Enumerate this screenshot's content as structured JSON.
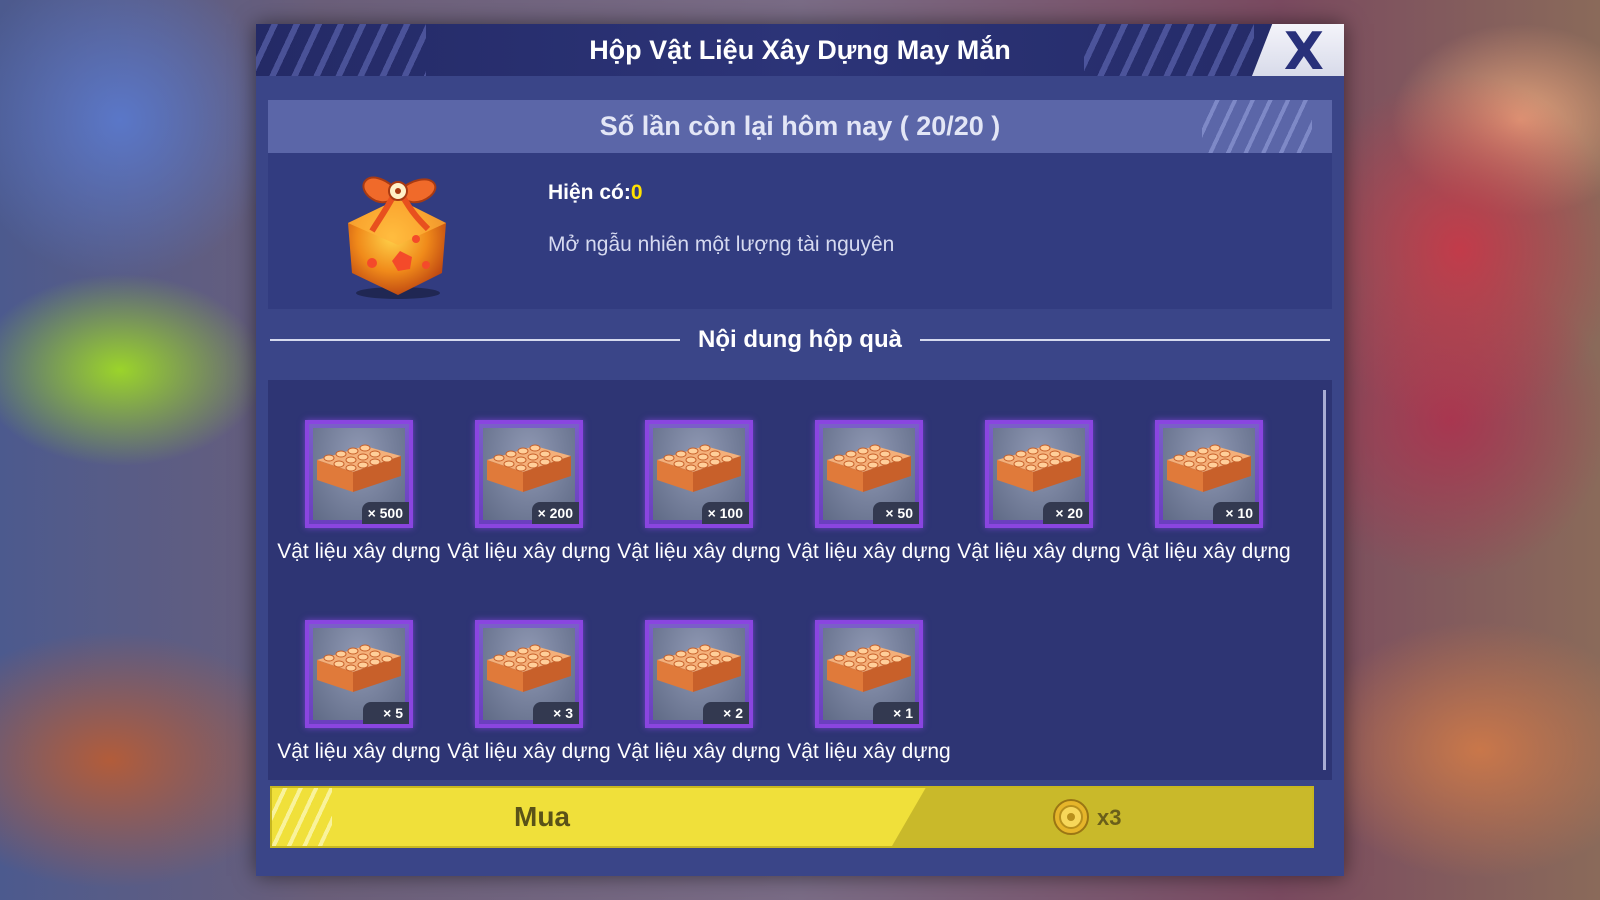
{
  "dialog": {
    "title": "Hộp Vật Liệu Xây Dựng May Mắn",
    "close_label": "X",
    "daily_count": "Số lần còn lại hôm nay ( 20/20 )",
    "owned_label": "Hiện có:",
    "owned_value": "0",
    "description": "Mở ngẫu nhiên một lượng tài nguyên",
    "section_title": "Nội dung hộp quà",
    "items": [
      {
        "qty": "× 500",
        "label": "Vật liệu xây dựng",
        "icon": "lego-brick-icon"
      },
      {
        "qty": "× 200",
        "label": "Vật liệu xây dựng",
        "icon": "lego-brick-icon"
      },
      {
        "qty": "× 100",
        "label": "Vật liệu xây dựng",
        "icon": "lego-brick-icon"
      },
      {
        "qty": "× 50",
        "label": "Vật liệu xây dựng",
        "icon": "lego-brick-icon"
      },
      {
        "qty": "× 20",
        "label": "Vật liệu xây dựng",
        "icon": "lego-brick-icon"
      },
      {
        "qty": "× 10",
        "label": "Vật liệu xây dựng",
        "icon": "lego-brick-icon"
      },
      {
        "qty": "× 5",
        "label": "Vật liệu xây dựng",
        "icon": "lego-brick-icon"
      },
      {
        "qty": "× 3",
        "label": "Vật liệu xây dựng",
        "icon": "lego-brick-icon"
      },
      {
        "qty": "× 2",
        "label": "Vật liệu xây dựng",
        "icon": "lego-brick-icon"
      },
      {
        "qty": "× 1",
        "label": "Vật liệu xây dựng",
        "icon": "lego-brick-icon"
      }
    ],
    "buy": {
      "label": "Mua",
      "price": "x3",
      "currency_icon": "gold-coin-icon"
    }
  },
  "colors": {
    "title_bar": "#242a66",
    "panel": "#3a4588",
    "slot_border": "#8a45e0",
    "buy_button": "#f0e03a",
    "highlight_value": "#ffe100"
  }
}
